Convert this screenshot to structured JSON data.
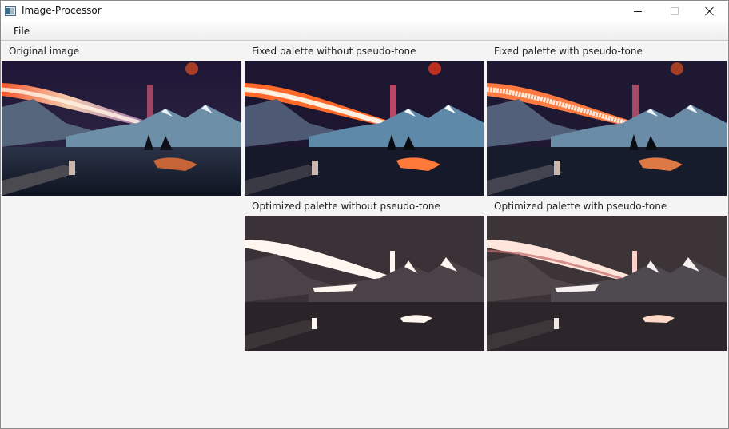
{
  "window": {
    "title": "Image-Processor",
    "icon": "app-window-icon",
    "controls": {
      "minimize": "minimize-icon",
      "maximize": "maximize-icon",
      "close": "close-icon"
    }
  },
  "menu": {
    "items": [
      "File"
    ]
  },
  "panels": {
    "original": {
      "caption": "Original image"
    },
    "fixed_no_pt": {
      "caption": "Fixed palette without pseudo-tone"
    },
    "fixed_pt": {
      "caption": "Fixed palette with pseudo-tone"
    },
    "opt_no_pt": {
      "caption": "Optimized palette without pseudo-tone"
    },
    "opt_pt": {
      "caption": "Optimized palette with pseudo-tone"
    }
  },
  "colors": {
    "window_bg": "#f4f4f4",
    "sky": "#1c1630",
    "glow": "#ff7a3a",
    "mountain": "#6e8fa8",
    "water": "#132032",
    "opt_bg": "#3a3236",
    "opt_highlight": "#fff6f0"
  }
}
